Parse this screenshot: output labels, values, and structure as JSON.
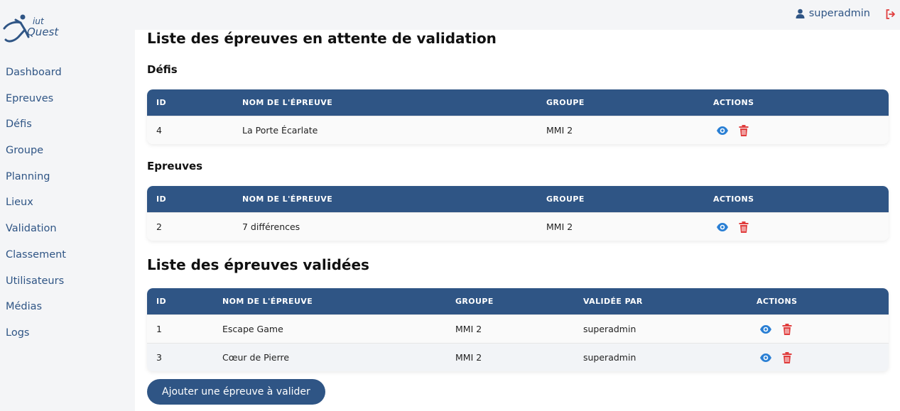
{
  "header": {
    "username": "superadmin"
  },
  "sidebar": {
    "items": [
      {
        "label": "Dashboard"
      },
      {
        "label": "Epreuves"
      },
      {
        "label": "Défis"
      },
      {
        "label": "Groupe"
      },
      {
        "label": "Planning"
      },
      {
        "label": "Lieux"
      },
      {
        "label": "Validation"
      },
      {
        "label": "Classement"
      },
      {
        "label": "Utilisateurs"
      },
      {
        "label": "Médias"
      },
      {
        "label": "Logs"
      }
    ]
  },
  "pending": {
    "title": "Liste des épreuves en attente de validation",
    "defis": {
      "title": "Défis",
      "columns": [
        "ID",
        "NOM DE L'ÉPREUVE",
        "GROUPE",
        "ACTIONS"
      ],
      "rows": [
        {
          "id": "4",
          "name": "La Porte Écarlate",
          "group": "MMI 2"
        }
      ]
    },
    "epreuves": {
      "title": "Epreuves",
      "columns": [
        "ID",
        "NOM DE L'ÉPREUVE",
        "GROUPE",
        "ACTIONS"
      ],
      "rows": [
        {
          "id": "2",
          "name": "7 différences",
          "group": "MMI 2"
        }
      ]
    }
  },
  "validated": {
    "title": "Liste des épreuves validées",
    "columns": [
      "ID",
      "NOM DE L'ÉPREUVE",
      "GROUPE",
      "VALIDÉE PAR",
      "ACTIONS"
    ],
    "rows": [
      {
        "id": "1",
        "name": "Escape Game",
        "group": "MMI 2",
        "validated_by": "superadmin"
      },
      {
        "id": "3",
        "name": "Cœur de Pierre",
        "group": "MMI 2",
        "validated_by": "superadmin"
      }
    ]
  },
  "add_button": "Ajouter une épreuve à valider",
  "colors": {
    "primary": "#2f5585",
    "eye": "#2a7fd4",
    "trash": "#e03c3c"
  }
}
